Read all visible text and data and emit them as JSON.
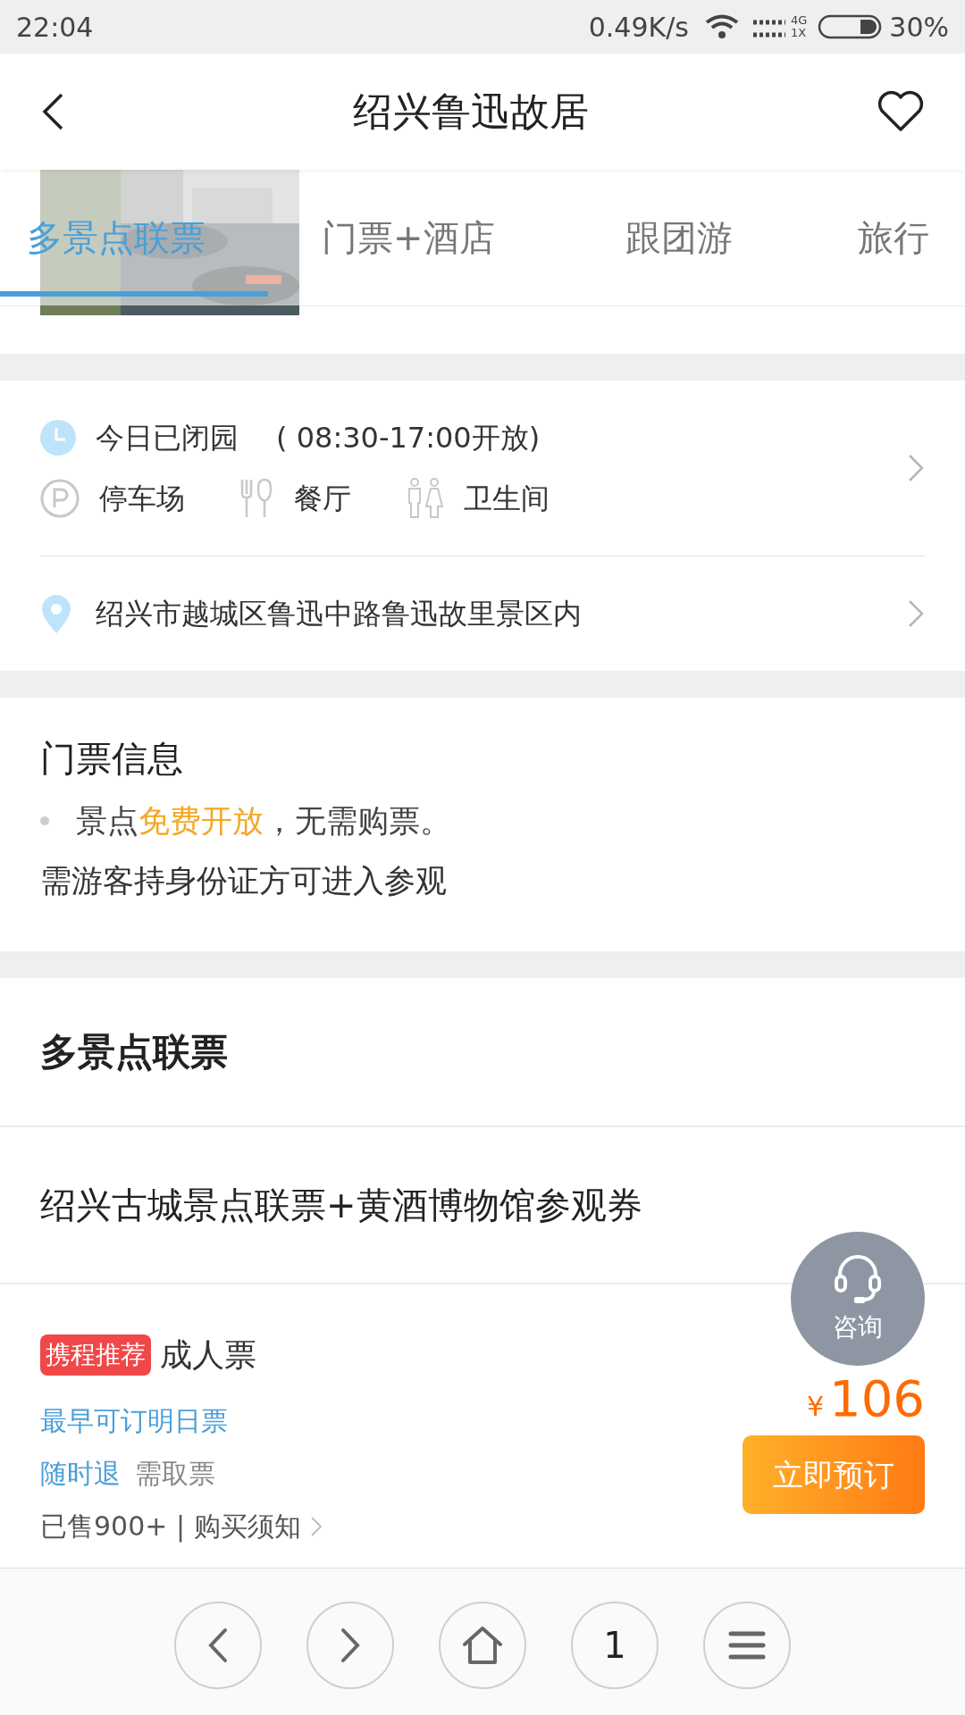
{
  "status_bar": {
    "time": "22:04",
    "speed": "0.49K/s",
    "network_top": "4G",
    "network_bottom": "1X",
    "battery": "30%"
  },
  "header": {
    "title": "绍兴鲁迅故居",
    "favorited": false
  },
  "tabs": [
    {
      "label": "多景点联票",
      "selected": true
    },
    {
      "label": "门票+酒店",
      "selected": false
    },
    {
      "label": "跟团游",
      "selected": false
    },
    {
      "label": "旅行",
      "selected": false
    }
  ],
  "hours": {
    "status": "今日已闭园",
    "open": "( 08:30-17:00开放)"
  },
  "facilities": [
    {
      "kind": "parking",
      "label": "停车场"
    },
    {
      "kind": "restaurant",
      "label": "餐厅"
    },
    {
      "kind": "toilet",
      "label": "卫生间"
    }
  ],
  "address": "绍兴市越城区鲁迅中路鲁迅故里景区内",
  "ticket_info": {
    "title": "门票信息",
    "bullet": "景点**免费开放**，无需购票。",
    "note": "需游客持身份证方可进入参观"
  },
  "section": {
    "title": "多景点联票"
  },
  "product": {
    "title": "绍兴古城景点联票+黄酒博物馆参观券"
  },
  "offer": {
    "badge": "携程推荐",
    "name": "成人票",
    "earliest": "最早可订明日票",
    "refund": "随时退",
    "pickup": "需取票",
    "sold": "已售900+ | 购买须知",
    "currency": "¥",
    "price": "106",
    "book": "立即预订"
  },
  "consult": "咨询",
  "nav": {
    "page": "1"
  }
}
